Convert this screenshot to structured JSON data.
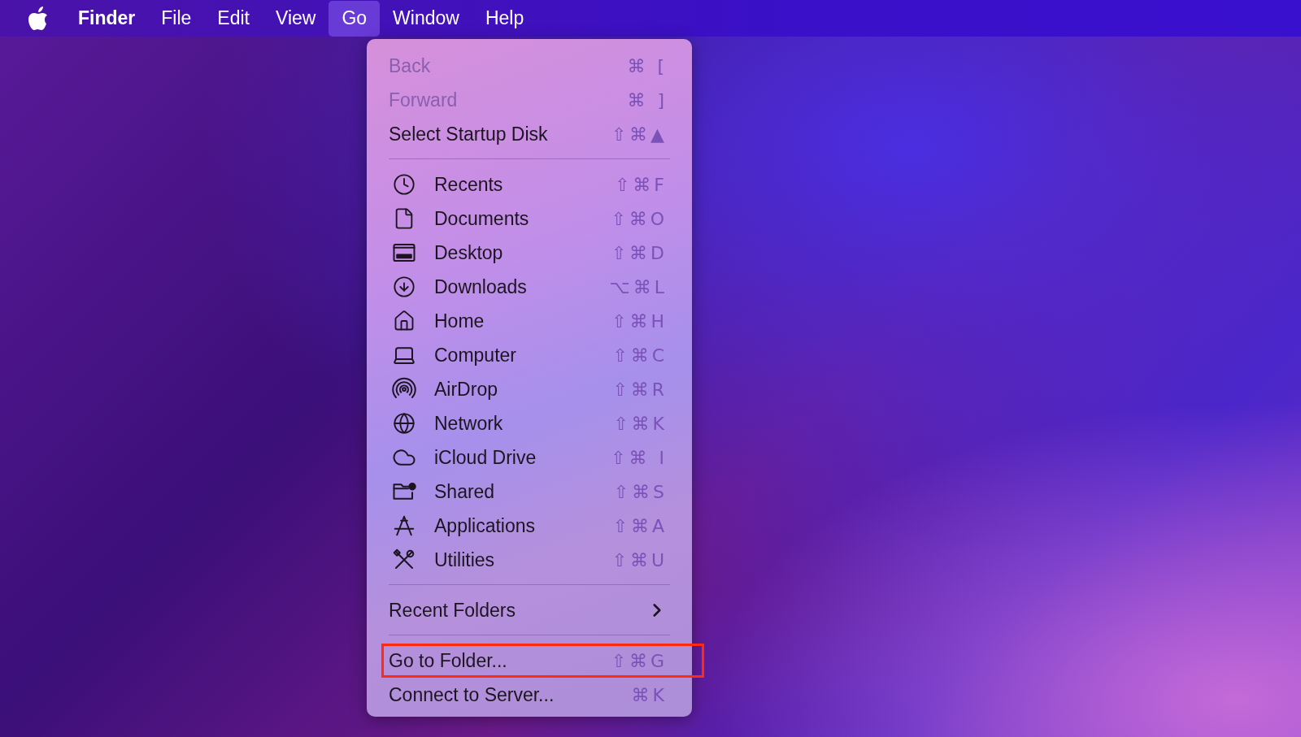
{
  "menu_bar": {
    "items": [
      {
        "label": "Finder",
        "kind": "app",
        "selected": false
      },
      {
        "label": "File",
        "kind": "menu",
        "selected": false
      },
      {
        "label": "Edit",
        "kind": "menu",
        "selected": false
      },
      {
        "label": "View",
        "kind": "menu",
        "selected": false
      },
      {
        "label": "Go",
        "kind": "menu",
        "selected": true
      },
      {
        "label": "Window",
        "kind": "menu",
        "selected": false
      },
      {
        "label": "Help",
        "kind": "menu",
        "selected": false
      }
    ]
  },
  "go_menu": {
    "items": [
      {
        "kind": "plain",
        "label": "Back",
        "shortcut": "⌘ [",
        "disabled": true,
        "highlighted": false
      },
      {
        "kind": "plain",
        "label": "Forward",
        "shortcut": "⌘ ]",
        "disabled": true,
        "highlighted": false
      },
      {
        "kind": "plain",
        "label": "Select Startup Disk",
        "shortcut": "⇧⌘▲",
        "disabled": false,
        "highlighted": false
      },
      {
        "kind": "separator"
      },
      {
        "kind": "place",
        "label": "Recents",
        "shortcut": "⇧⌘F",
        "disabled": false,
        "highlighted": false
      },
      {
        "kind": "place",
        "label": "Documents",
        "shortcut": "⇧⌘O",
        "disabled": false,
        "highlighted": false
      },
      {
        "kind": "place",
        "label": "Desktop",
        "shortcut": "⇧⌘D",
        "disabled": false,
        "highlighted": false
      },
      {
        "kind": "place",
        "label": "Downloads",
        "shortcut": "⌥⌘L",
        "disabled": false,
        "highlighted": false
      },
      {
        "kind": "place",
        "label": "Home",
        "shortcut": "⇧⌘H",
        "disabled": false,
        "highlighted": false
      },
      {
        "kind": "place",
        "label": "Computer",
        "shortcut": "⇧⌘C",
        "disabled": false,
        "highlighted": false
      },
      {
        "kind": "place",
        "label": "AirDrop",
        "shortcut": "⇧⌘R",
        "disabled": false,
        "highlighted": false
      },
      {
        "kind": "place",
        "label": "Network",
        "shortcut": "⇧⌘K",
        "disabled": false,
        "highlighted": false
      },
      {
        "kind": "place",
        "label": "iCloud Drive",
        "shortcut": "⇧⌘ I",
        "disabled": false,
        "highlighted": false
      },
      {
        "kind": "place",
        "label": "Shared",
        "shortcut": "⇧⌘S",
        "disabled": false,
        "highlighted": false
      },
      {
        "kind": "place",
        "label": "Applications",
        "shortcut": "⇧⌘A",
        "disabled": false,
        "highlighted": false
      },
      {
        "kind": "place",
        "label": "Utilities",
        "shortcut": "⇧⌘U",
        "disabled": false,
        "highlighted": false
      },
      {
        "kind": "separator"
      },
      {
        "kind": "submenu",
        "label": "Recent Folders",
        "disabled": false,
        "highlighted": false
      },
      {
        "kind": "separator"
      },
      {
        "kind": "plain",
        "label": "Go to Folder...",
        "shortcut": "⇧⌘G",
        "disabled": false,
        "highlighted": true
      },
      {
        "kind": "plain",
        "label": "Connect to Server...",
        "shortcut": "⌘K",
        "disabled": false,
        "highlighted": false
      }
    ]
  }
}
